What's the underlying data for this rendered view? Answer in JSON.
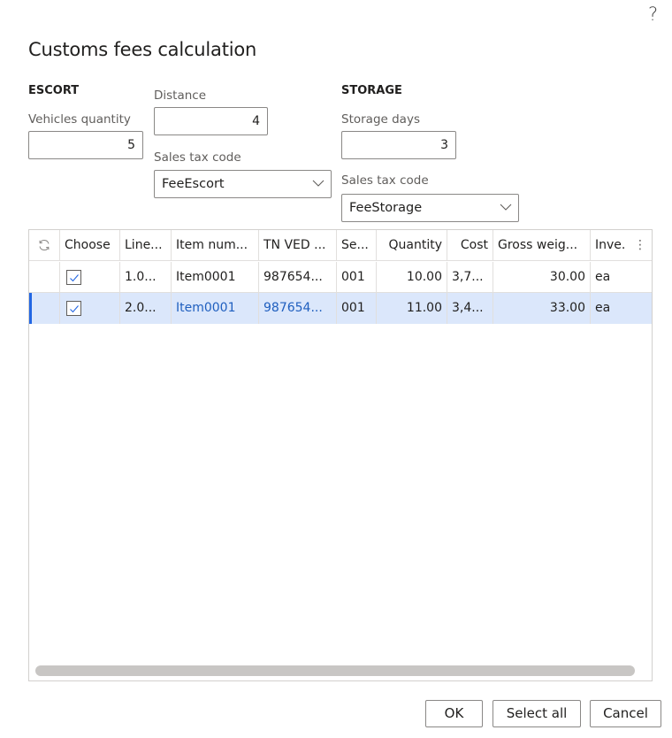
{
  "dialog": {
    "title": "Customs fees calculation",
    "help_label": "?"
  },
  "escort": {
    "heading": "ESCORT",
    "vehicles_quantity": {
      "label": "Vehicles quantity",
      "value": "5"
    },
    "distance": {
      "label": "Distance",
      "value": "4"
    },
    "sales_tax_code": {
      "label": "Sales tax code",
      "value": "FeeEscort"
    }
  },
  "storage": {
    "heading": "STORAGE",
    "storage_days": {
      "label": "Storage days",
      "value": "3"
    },
    "sales_tax_code": {
      "label": "Sales tax code",
      "value": "FeeStorage"
    }
  },
  "grid": {
    "columns": [
      "Choose",
      "Line...",
      "Item num...",
      "TN VED ...",
      "Se...",
      "Quantity",
      "Cost",
      "Gross weig...",
      "Inve."
    ],
    "rows": [
      {
        "choose": true,
        "line": "1.0...",
        "item": "Item0001",
        "tnved": "987654...",
        "se": "001",
        "quantity": "10.00",
        "cost": "3,7...",
        "gross": "30.00",
        "inve": "ea",
        "selected": false
      },
      {
        "choose": true,
        "line": "2.0...",
        "item": "Item0001",
        "tnved": "987654...",
        "se": "001",
        "quantity": "11.00",
        "cost": "3,4...",
        "gross": "33.00",
        "inve": "ea",
        "selected": true
      }
    ]
  },
  "buttons": {
    "ok": "OK",
    "select_all": "Select all",
    "cancel": "Cancel"
  },
  "colors": {
    "accent": "#2266e3",
    "selected_row": "#dbe7fb",
    "link": "#1f5fbf"
  }
}
